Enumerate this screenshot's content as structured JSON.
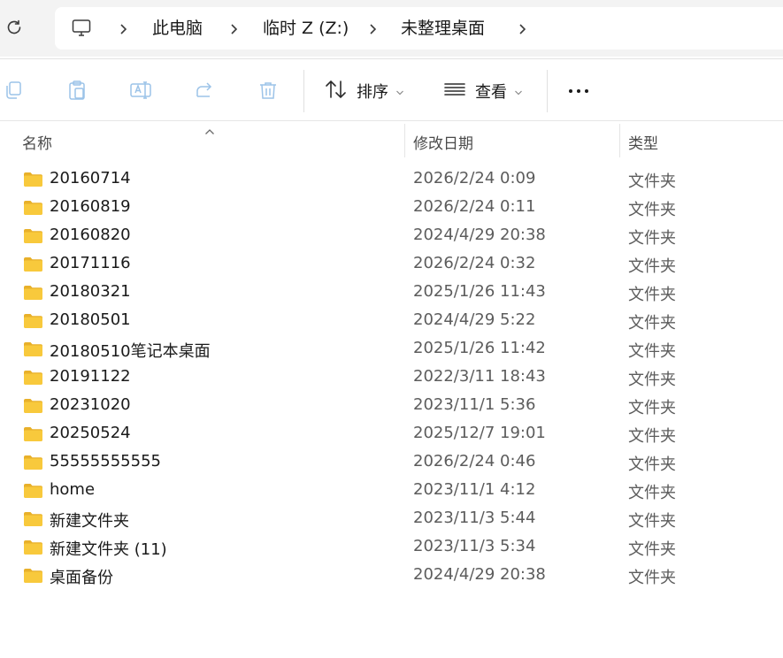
{
  "address_bar": {
    "breadcrumbs": [
      {
        "label": "此电脑"
      },
      {
        "label": "临时 Z (Z:)"
      },
      {
        "label": "未整理桌面"
      }
    ]
  },
  "toolbar": {
    "sort_label": "排序",
    "view_label": "查看"
  },
  "columns": {
    "name": "名称",
    "date": "修改日期",
    "type": "类型"
  },
  "files": [
    {
      "name": "20160714",
      "date": "2026/2/24 0:09",
      "type": "文件夹"
    },
    {
      "name": "20160819",
      "date": "2026/2/24 0:11",
      "type": "文件夹"
    },
    {
      "name": "20160820",
      "date": "2024/4/29 20:38",
      "type": "文件夹"
    },
    {
      "name": "20171116",
      "date": "2026/2/24 0:32",
      "type": "文件夹"
    },
    {
      "name": "20180321",
      "date": "2025/1/26 11:43",
      "type": "文件夹"
    },
    {
      "name": "20180501",
      "date": "2024/4/29 5:22",
      "type": "文件夹"
    },
    {
      "name": "20180510笔记本桌面",
      "date": "2025/1/26 11:42",
      "type": "文件夹"
    },
    {
      "name": "20191122",
      "date": "2022/3/11 18:43",
      "type": "文件夹"
    },
    {
      "name": "20231020",
      "date": "2023/11/1 5:36",
      "type": "文件夹"
    },
    {
      "name": "20250524",
      "date": "2025/12/7 19:01",
      "type": "文件夹"
    },
    {
      "name": "55555555555",
      "date": "2026/2/24 0:46",
      "type": "文件夹"
    },
    {
      "name": "home",
      "date": "2023/11/1 4:12",
      "type": "文件夹"
    },
    {
      "name": "新建文件夹",
      "date": "2023/11/3 5:44",
      "type": "文件夹"
    },
    {
      "name": "新建文件夹 (11)",
      "date": "2023/11/3 5:34",
      "type": "文件夹"
    },
    {
      "name": "桌面备份",
      "date": "2024/4/29 20:38",
      "type": "文件夹"
    }
  ],
  "icons": {
    "refresh": "refresh-icon",
    "computer": "computer-icon",
    "folder": "folder-icon",
    "copy": "copy-icon",
    "paste": "paste-icon",
    "rename": "rename-icon",
    "share": "share-icon",
    "delete": "delete-icon",
    "sort": "sort-icon",
    "view": "view-icon",
    "more": "more-icon"
  },
  "colors": {
    "folder": "#f8c93c",
    "folder_tab": "#e8b02a",
    "toolbar_icon_disabled": "#9cc3e8",
    "address_bar_bg": "#f3f3f3"
  }
}
